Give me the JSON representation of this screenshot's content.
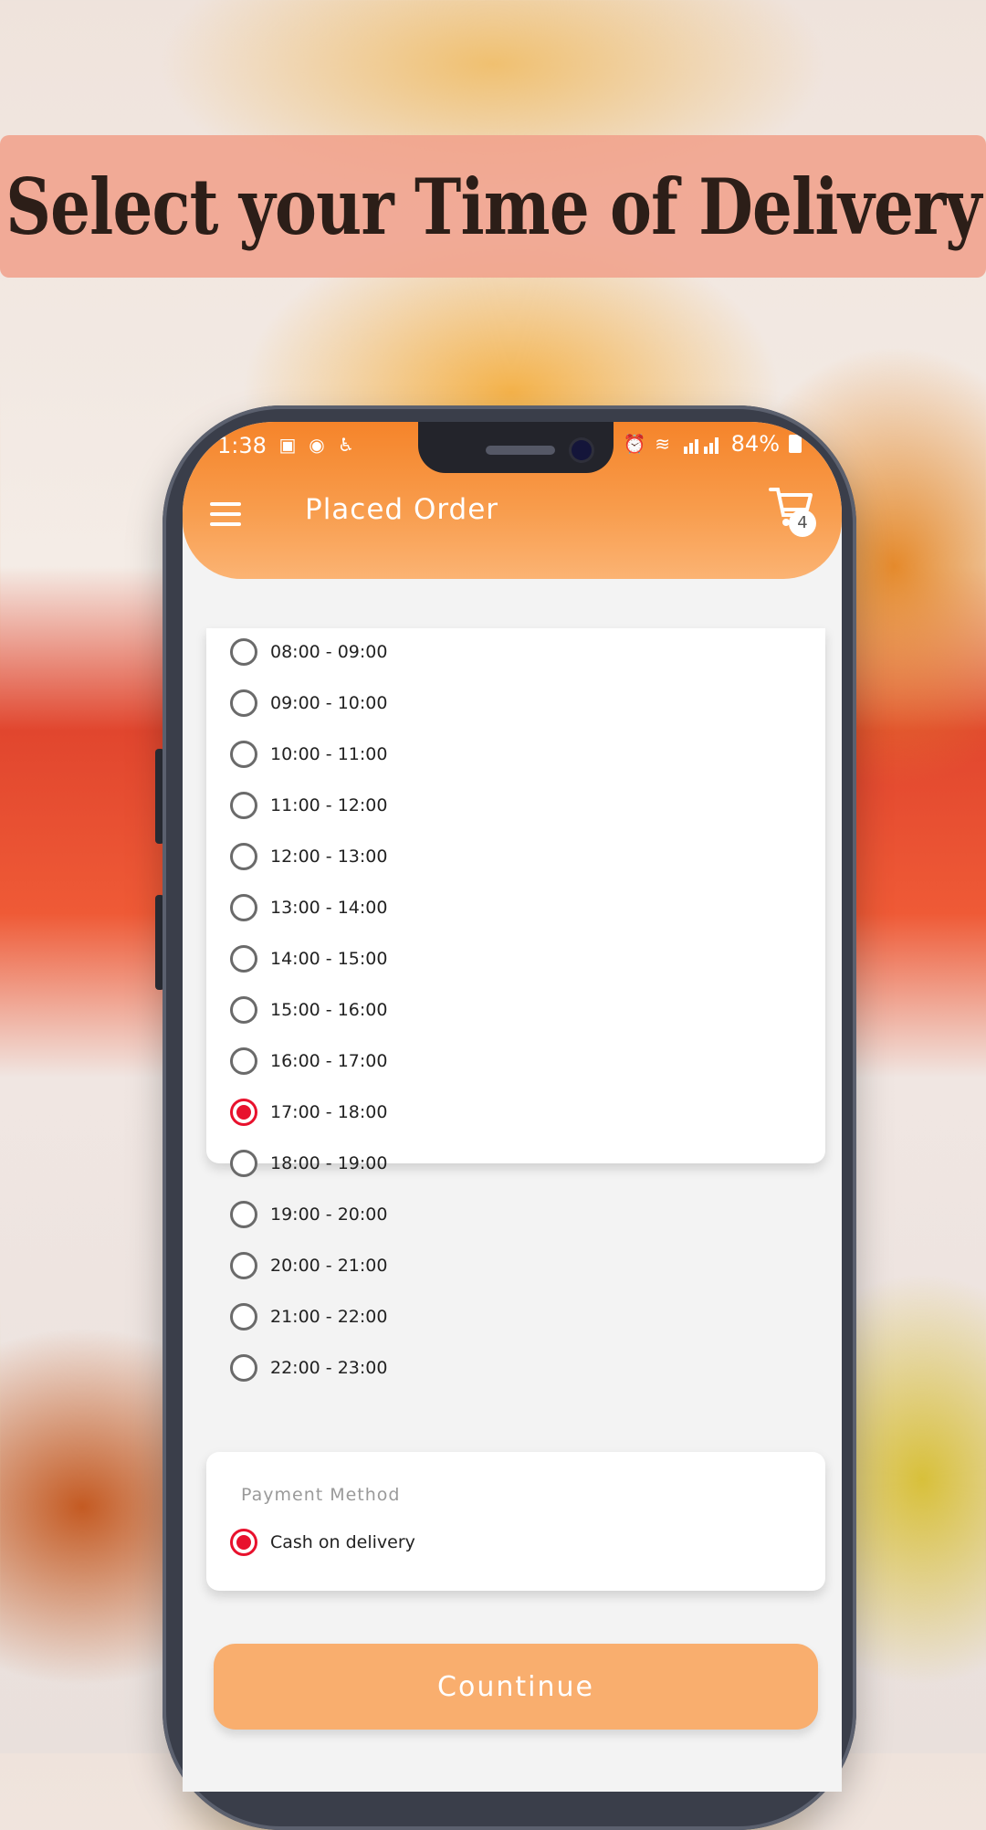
{
  "banner": {
    "title": "Select your Time of Delivery"
  },
  "status_bar": {
    "time": "1:38",
    "battery": "84%"
  },
  "app_bar": {
    "title": "Placed Order",
    "cart_count": "4"
  },
  "time_slots": [
    {
      "label": "08:00 - 09:00",
      "selected": false
    },
    {
      "label": "09:00 - 10:00",
      "selected": false
    },
    {
      "label": "10:00 - 11:00",
      "selected": false
    },
    {
      "label": "11:00 - 12:00",
      "selected": false
    },
    {
      "label": "12:00 - 13:00",
      "selected": false
    },
    {
      "label": "13:00 - 14:00",
      "selected": false
    },
    {
      "label": "14:00 - 15:00",
      "selected": false
    },
    {
      "label": "15:00 - 16:00",
      "selected": false
    },
    {
      "label": "16:00 - 17:00",
      "selected": false
    },
    {
      "label": "17:00 - 18:00",
      "selected": true
    },
    {
      "label": "18:00 - 19:00",
      "selected": false
    },
    {
      "label": "19:00 - 20:00",
      "selected": false
    },
    {
      "label": "20:00 - 21:00",
      "selected": false
    },
    {
      "label": "21:00 - 22:00",
      "selected": false
    },
    {
      "label": "22:00 - 23:00",
      "selected": false
    }
  ],
  "payment": {
    "title": "Payment Method",
    "option": "Cash on delivery",
    "selected": true
  },
  "continue_label": "Countinue",
  "colors": {
    "accent": "#f5842a",
    "radio_selected": "#e8112d",
    "button": "#f9ae6e"
  }
}
